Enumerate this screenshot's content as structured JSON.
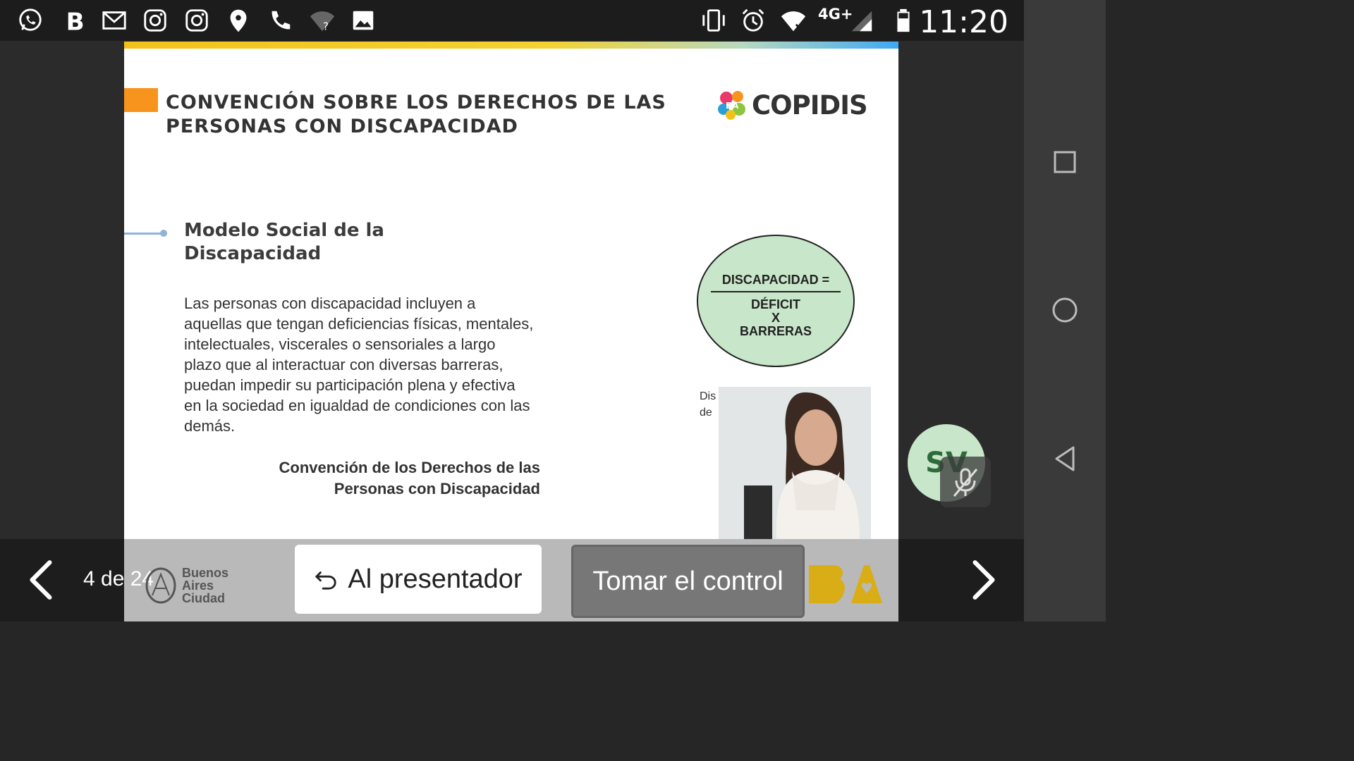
{
  "status_bar": {
    "time": "11:20",
    "network": "4G+",
    "icons": [
      "whatsapp-icon",
      "b-app-icon",
      "gmail-icon",
      "instagram-icon",
      "instagram-icon",
      "location-icon",
      "phone-icon",
      "wifi-unknown-icon",
      "gallery-icon",
      "vibrate-icon",
      "alarm-icon",
      "wifi-icon",
      "signal-icon",
      "battery-icon"
    ]
  },
  "slide": {
    "title": "CONVENCIÓN SOBRE LOS DERECHOS DE LAS PERSONAS CON DISCAPACIDAD",
    "logo_text": "COPIDIS",
    "logo_mark_text": "BA",
    "subheading": "Modelo Social de la Discapacidad",
    "body": "Las personas con discapacidad incluyen a aquellas que tengan deficiencias físicas, mentales, intelectuales, viscerales o sensoriales a largo plazo que al interactuar con diversas barreras, puedan impedir su participación plena y efectiva en la sociedad en igualdad de condiciones con las demás.",
    "citation": "Convención de los Derechos de las Personas con Discapacidad",
    "formula": {
      "top": "DISCAPACIDAD =",
      "bottom_1": "DÉFICIT",
      "bottom_2": "X",
      "bottom_3": "BARRERAS"
    },
    "caption_1": "Dis",
    "caption_2": "de"
  },
  "participant": {
    "initials": "SV",
    "mic_muted": true
  },
  "toolbar": {
    "page_count": "4 de 24",
    "city_line_1": "Buenos",
    "city_line_2": "Aires",
    "city_line_3": "Ciudad",
    "presenter_label": "Al presentador",
    "control_label": "Tomar el control"
  },
  "colors": {
    "accent_orange": "#f7941d",
    "formula_green": "#c8e6c9",
    "ba_yellow": "#f3c21a"
  }
}
